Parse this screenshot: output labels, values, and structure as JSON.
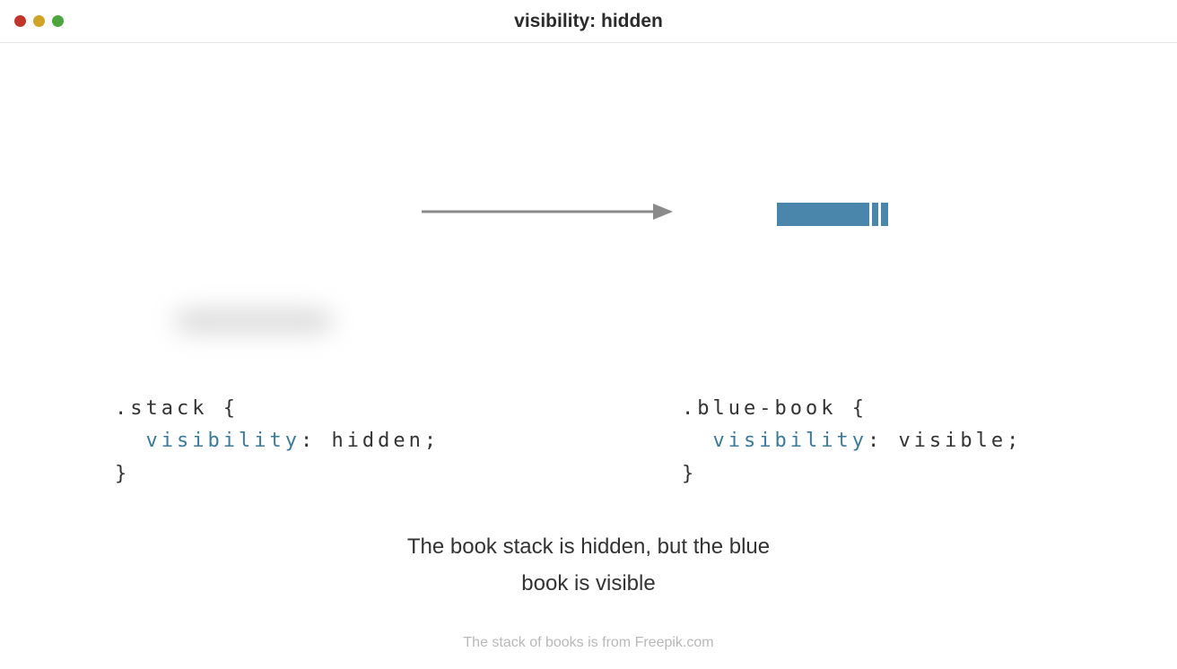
{
  "titlebar": {
    "title": "visibility: hidden"
  },
  "code_left": {
    "selector": ".stack {",
    "property": "visibility",
    "value": ": hidden;",
    "close": "}"
  },
  "code_right": {
    "selector": ".blue-book {",
    "property": "visibility",
    "value": ": visible;",
    "close": "}"
  },
  "caption": {
    "line1": "The book stack is hidden, but the blue",
    "line2": "book is visible"
  },
  "credit": "The stack of books is from Freepik.com"
}
